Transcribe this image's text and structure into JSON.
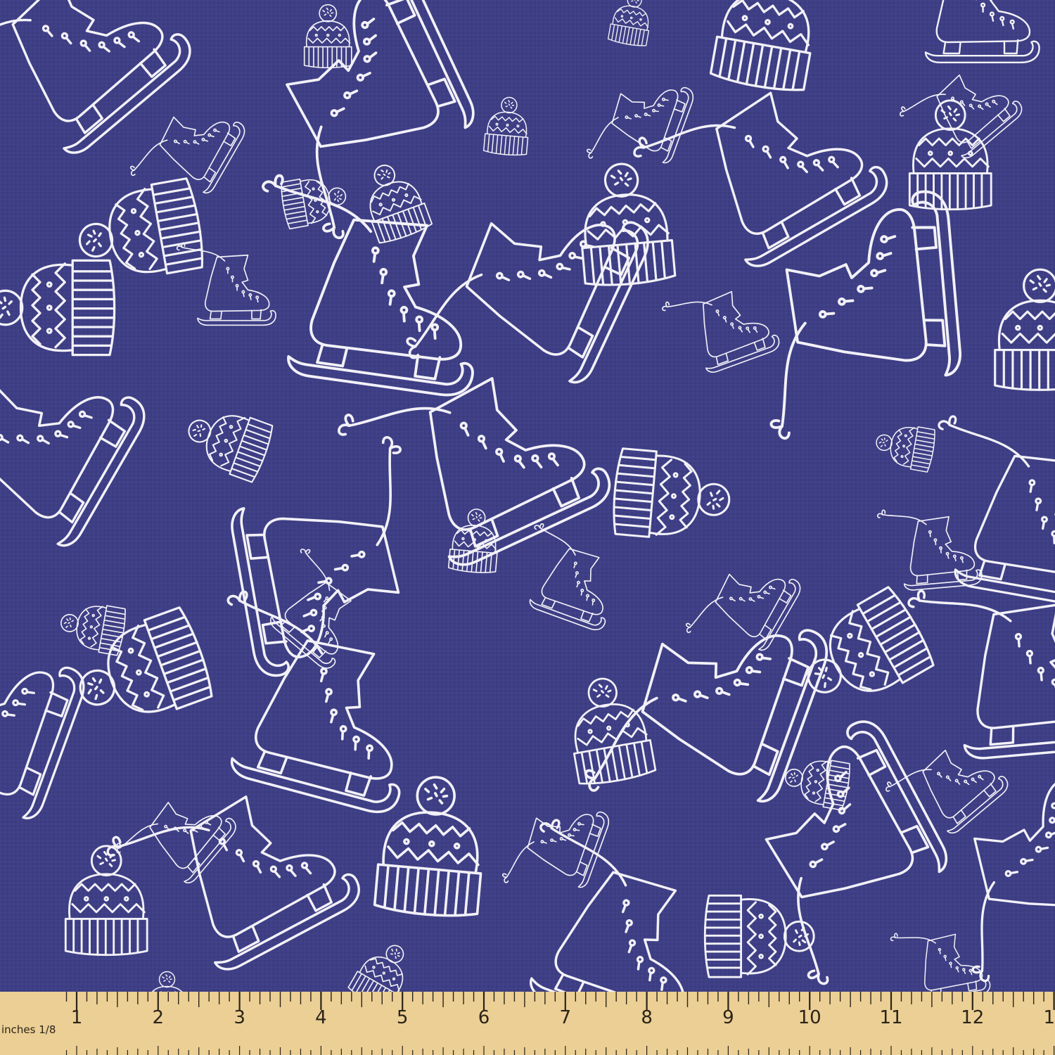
{
  "fabric": {
    "background_color": "#3f3f86",
    "line_color": "#f2f1f7",
    "motifs": [
      "ice-skate",
      "knit-beanie-with-pompom"
    ]
  },
  "ruler": {
    "background_color": "#ebcf95",
    "tick_color": "#2b2417",
    "unit_label": "inches 1/8",
    "numbers": [
      "1",
      "2",
      "3",
      "4",
      "5",
      "6",
      "7",
      "8",
      "9",
      "10",
      "11",
      "12",
      "1"
    ]
  }
}
